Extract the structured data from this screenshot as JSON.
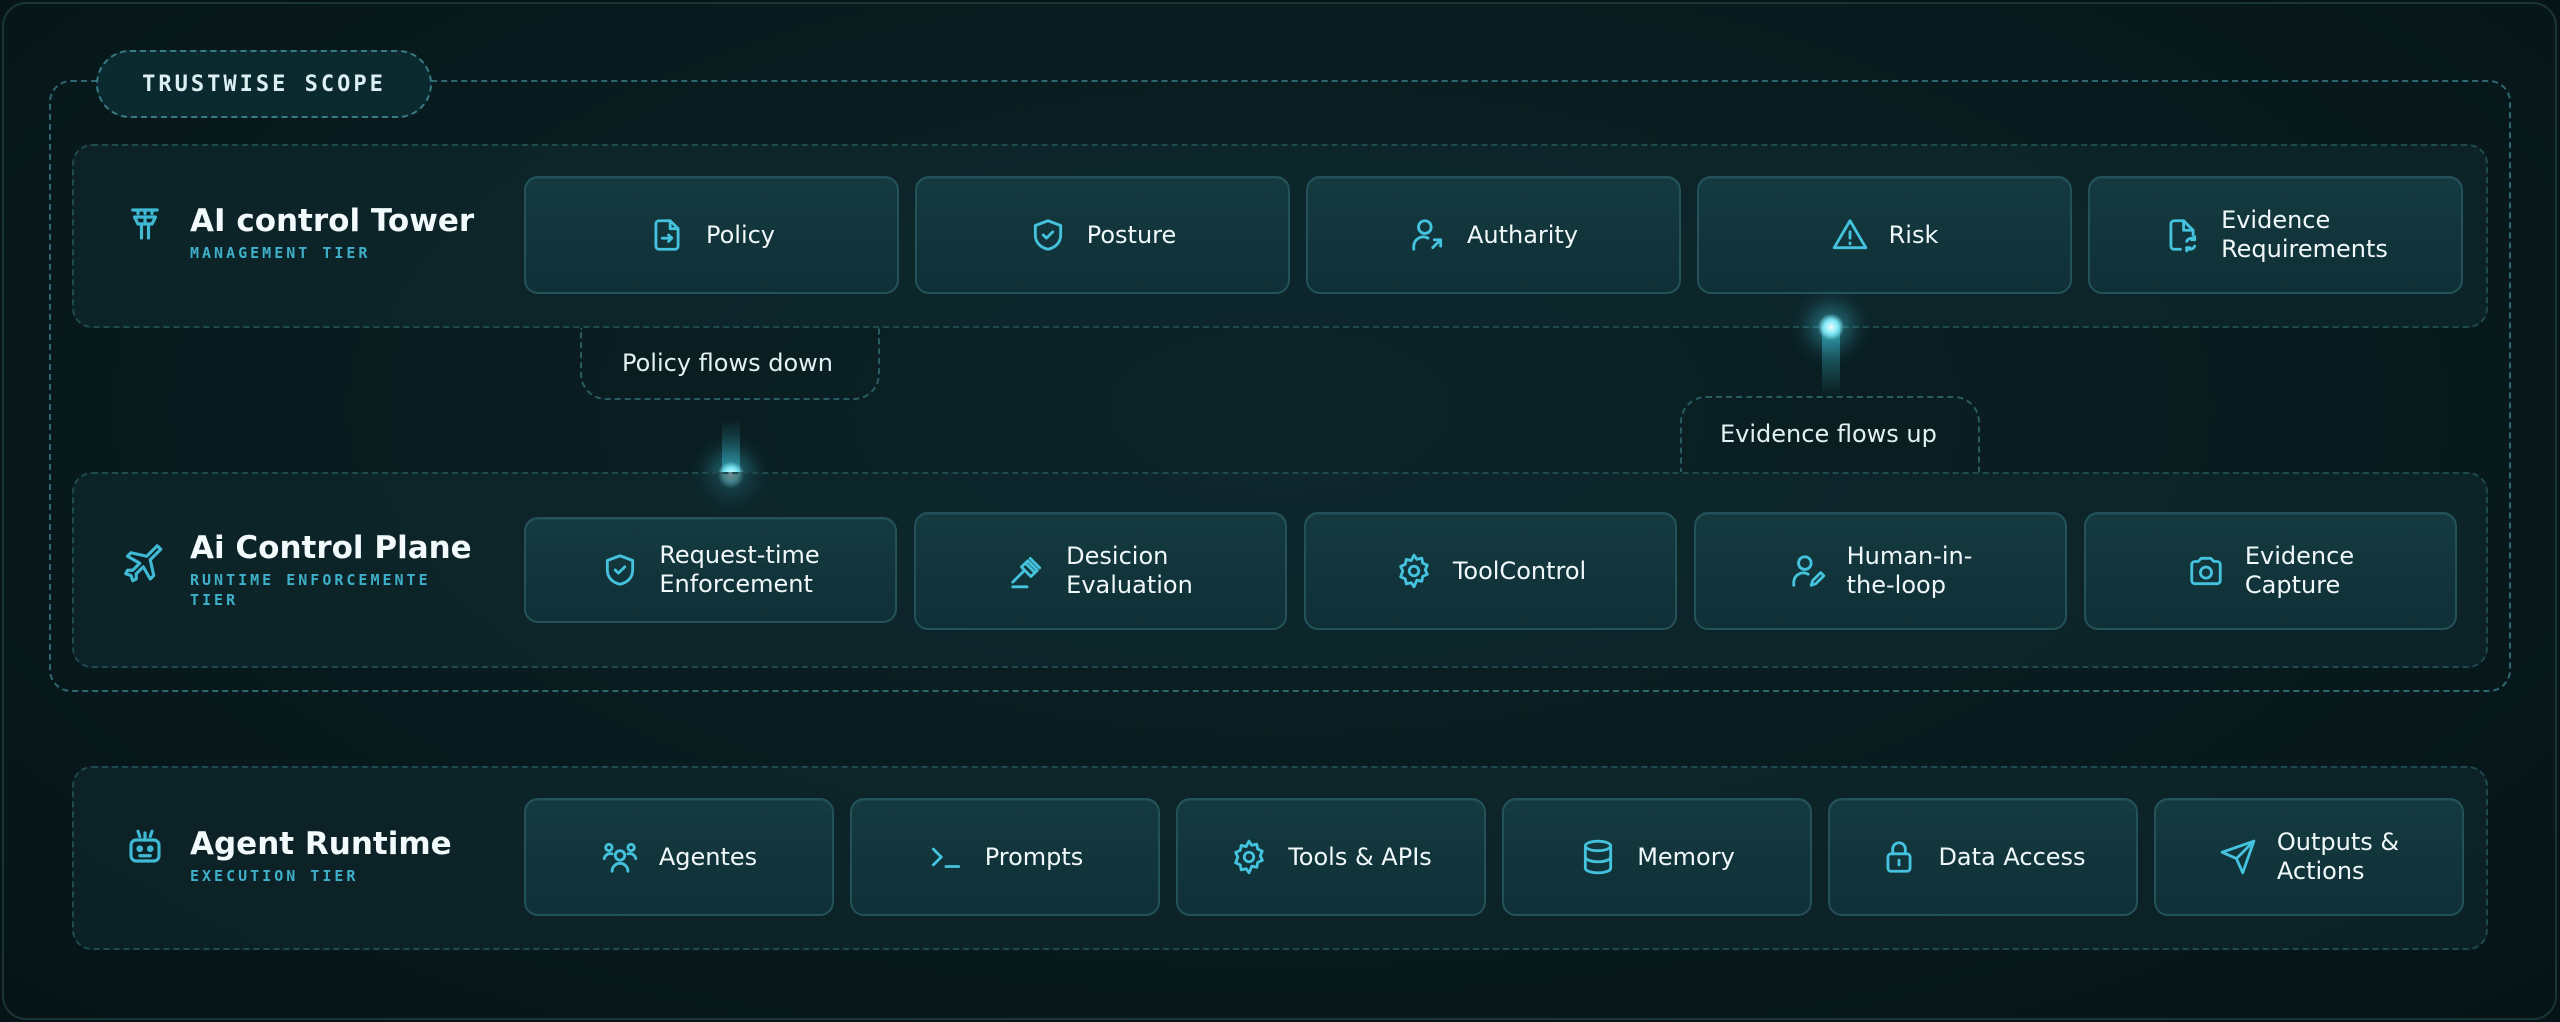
{
  "scope_label": "TRUSTWISE SCOPE",
  "tiers": [
    {
      "title": "AI control Tower",
      "subtitle": "MANAGEMENT TIER",
      "icon": "control-tower-icon",
      "cards": [
        {
          "label": "Policy",
          "icon": "file-arrow-icon"
        },
        {
          "label": "Posture",
          "icon": "shield-check-icon"
        },
        {
          "label": "Autharity",
          "icon": "user-arrow-icon"
        },
        {
          "label": "Risk",
          "icon": "warning-triangle-icon"
        },
        {
          "label": "Evidence\nRequirements",
          "icon": "file-sync-icon"
        }
      ]
    },
    {
      "title": "Ai Control Plane",
      "subtitle": "RUNTIME ENFORCEMENTE\nTIER",
      "icon": "airplane-icon",
      "cards": [
        {
          "label": "Request-time\nEnforcement",
          "icon": "shield-check-icon"
        },
        {
          "label": "Desicion\nEvaluation",
          "icon": "gavel-icon"
        },
        {
          "label": "ToolControl",
          "icon": "gear-icon"
        },
        {
          "label": "Human-in-\nthe-loop",
          "icon": "user-edit-icon"
        },
        {
          "label": "Evidence\nCapture",
          "icon": "camera-icon"
        }
      ]
    },
    {
      "title": "Agent Runtime",
      "subtitle": "EXECUTION TIER",
      "icon": "robot-icon",
      "cards": [
        {
          "label": "Agentes",
          "icon": "users-group-icon"
        },
        {
          "label": "Prompts",
          "icon": "terminal-icon"
        },
        {
          "label": "Tools & APIs",
          "icon": "gear-icon"
        },
        {
          "label": "Memory",
          "icon": "database-icon"
        },
        {
          "label": "Data Access",
          "icon": "lock-icon"
        },
        {
          "label": "Outputs &\nActions",
          "icon": "send-icon"
        }
      ]
    }
  ],
  "flows": {
    "down": "Policy flows down",
    "up": "Evidence flows up"
  },
  "accent_color": "#3fb9d4"
}
